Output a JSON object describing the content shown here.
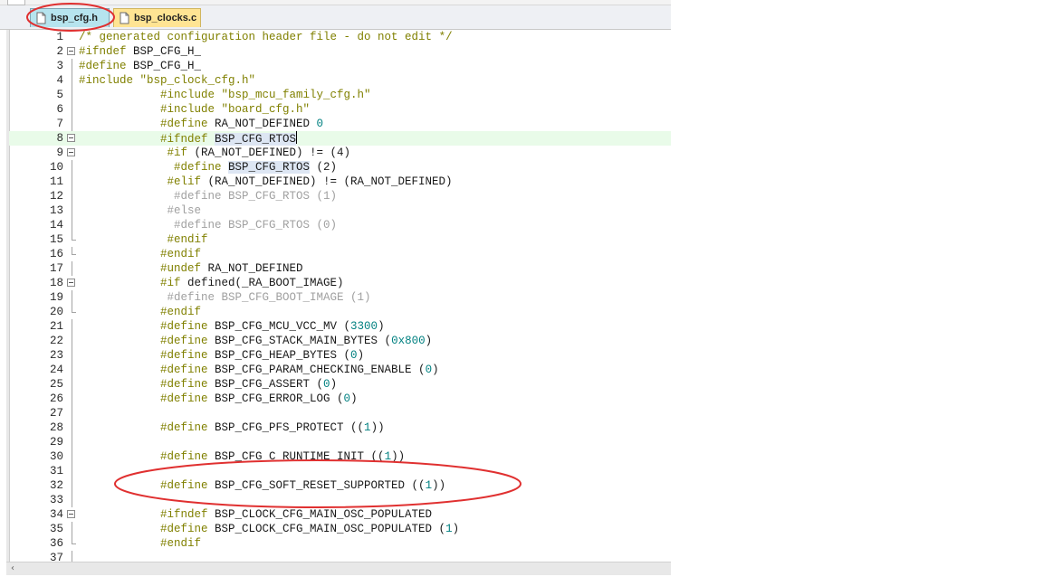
{
  "tabs": [
    {
      "label": "bsp_cfg.h",
      "active": true,
      "icon": "c-header-file-icon"
    },
    {
      "label": "bsp_clocks.c",
      "active": false,
      "icon": "c-source-file-icon"
    }
  ],
  "lines": [
    {
      "n": "1",
      "indent": 0,
      "cls": "comment",
      "segs": [
        [
          "/* generated configuration header file - do not edit */",
          ""
        ]
      ]
    },
    {
      "n": "2",
      "indent": 0,
      "fold": "open",
      "segs": [
        [
          "#ifndef",
          "pp"
        ],
        [
          " BSP_CFG_H_",
          ""
        ]
      ]
    },
    {
      "n": "3",
      "indent": 0,
      "fold": "bar",
      "segs": [
        [
          "#define",
          "pp"
        ],
        [
          " BSP_CFG_H_",
          ""
        ]
      ]
    },
    {
      "n": "4",
      "indent": 0,
      "fold": "bar",
      "segs": [
        [
          "#include",
          "pp"
        ],
        [
          " ",
          ""
        ],
        [
          "\"bsp_clock_cfg.h\"",
          "str"
        ]
      ]
    },
    {
      "n": "5",
      "indent": 12,
      "fold": "bar",
      "segs": [
        [
          "#include",
          "pp"
        ],
        [
          " ",
          ""
        ],
        [
          "\"bsp_mcu_family_cfg.h\"",
          "str"
        ]
      ]
    },
    {
      "n": "6",
      "indent": 12,
      "fold": "bar",
      "segs": [
        [
          "#include",
          "pp"
        ],
        [
          " ",
          ""
        ],
        [
          "\"board_cfg.h\"",
          "str"
        ]
      ]
    },
    {
      "n": "7",
      "indent": 12,
      "fold": "bar",
      "segs": [
        [
          "#define",
          "pp"
        ],
        [
          " RA_NOT_DEFINED ",
          ""
        ],
        [
          "0",
          "num"
        ]
      ]
    },
    {
      "n": "8",
      "indent": 12,
      "fold": "open",
      "hl": true,
      "cursor": true,
      "segs": [
        [
          "#ifndef",
          "pp"
        ],
        [
          " ",
          ""
        ],
        [
          "BSP_CFG_RTOS",
          "sel"
        ]
      ]
    },
    {
      "n": "9",
      "indent": 13,
      "fold": "open",
      "segs": [
        [
          "#if",
          "pp"
        ],
        [
          " (RA_NOT_DEFINED) != (4)",
          ""
        ]
      ]
    },
    {
      "n": "10",
      "indent": 14,
      "fold": "bar",
      "segs": [
        [
          "#define",
          "pp"
        ],
        [
          " ",
          ""
        ],
        [
          "BSP_CFG_RTOS",
          "sel"
        ],
        [
          " (2)",
          ""
        ]
      ]
    },
    {
      "n": "11",
      "indent": 13,
      "fold": "bar",
      "segs": [
        [
          "#elif",
          "pp"
        ],
        [
          " (RA_NOT_DEFINED) != (RA_NOT_DEFINED)",
          "dim"
        ]
      ]
    },
    {
      "n": "12",
      "indent": 14,
      "fold": "bar",
      "cls": "dim",
      "segs": [
        [
          "#define BSP_CFG_RTOS (1)",
          ""
        ]
      ]
    },
    {
      "n": "13",
      "indent": 13,
      "fold": "bar",
      "cls": "dim",
      "segs": [
        [
          "#else",
          ""
        ]
      ]
    },
    {
      "n": "14",
      "indent": 14,
      "fold": "bar",
      "cls": "dim",
      "segs": [
        [
          "#define BSP_CFG_RTOS (0)",
          ""
        ]
      ]
    },
    {
      "n": "15",
      "indent": 13,
      "fold": "end",
      "segs": [
        [
          "#endif",
          "pp"
        ]
      ]
    },
    {
      "n": "16",
      "indent": 12,
      "fold": "end",
      "segs": [
        [
          "#endif",
          "pp"
        ]
      ]
    },
    {
      "n": "17",
      "indent": 12,
      "fold": "bar",
      "segs": [
        [
          "#undef",
          "pp"
        ],
        [
          " RA_NOT_DEFINED",
          ""
        ]
      ]
    },
    {
      "n": "18",
      "indent": 12,
      "fold": "open",
      "segs": [
        [
          "#if",
          "pp"
        ],
        [
          " defined(_RA_BOOT_IMAGE)",
          ""
        ]
      ]
    },
    {
      "n": "19",
      "indent": 13,
      "fold": "bar",
      "cls": "dim",
      "segs": [
        [
          "#define BSP_CFG_BOOT_IMAGE (1)",
          ""
        ]
      ]
    },
    {
      "n": "20",
      "indent": 12,
      "fold": "end",
      "segs": [
        [
          "#endif",
          "pp"
        ]
      ]
    },
    {
      "n": "21",
      "indent": 12,
      "fold": "bar",
      "segs": [
        [
          "#define",
          "pp"
        ],
        [
          " BSP_CFG_MCU_VCC_MV (",
          ""
        ],
        [
          "3300",
          "num"
        ],
        [
          ")",
          ""
        ]
      ]
    },
    {
      "n": "22",
      "indent": 12,
      "fold": "bar",
      "segs": [
        [
          "#define",
          "pp"
        ],
        [
          " BSP_CFG_STACK_MAIN_BYTES (",
          ""
        ],
        [
          "0x800",
          "num"
        ],
        [
          ")",
          ""
        ]
      ]
    },
    {
      "n": "23",
      "indent": 12,
      "fold": "bar",
      "segs": [
        [
          "#define",
          "pp"
        ],
        [
          " BSP_CFG_HEAP_BYTES (",
          ""
        ],
        [
          "0",
          "num"
        ],
        [
          ")",
          ""
        ]
      ]
    },
    {
      "n": "24",
      "indent": 12,
      "fold": "bar",
      "segs": [
        [
          "#define",
          "pp"
        ],
        [
          " BSP_CFG_PARAM_CHECKING_ENABLE (",
          ""
        ],
        [
          "0",
          "num"
        ],
        [
          ")",
          ""
        ]
      ]
    },
    {
      "n": "25",
      "indent": 12,
      "fold": "bar",
      "segs": [
        [
          "#define",
          "pp"
        ],
        [
          " BSP_CFG_ASSERT (",
          ""
        ],
        [
          "0",
          "num"
        ],
        [
          ")",
          ""
        ]
      ]
    },
    {
      "n": "26",
      "indent": 12,
      "fold": "bar",
      "segs": [
        [
          "#define",
          "pp"
        ],
        [
          " BSP_CFG_ERROR_LOG (",
          ""
        ],
        [
          "0",
          "num"
        ],
        [
          ")",
          ""
        ]
      ]
    },
    {
      "n": "27",
      "indent": 0,
      "fold": "bar",
      "segs": []
    },
    {
      "n": "28",
      "indent": 12,
      "fold": "bar",
      "segs": [
        [
          "#define",
          "pp"
        ],
        [
          " BSP_CFG_PFS_PROTECT ((",
          ""
        ],
        [
          "1",
          "num"
        ],
        [
          "))",
          ""
        ]
      ]
    },
    {
      "n": "29",
      "indent": 0,
      "fold": "bar",
      "segs": []
    },
    {
      "n": "30",
      "indent": 12,
      "fold": "bar",
      "segs": [
        [
          "#define",
          "pp"
        ],
        [
          " BSP_CFG_C_RUNTIME_INIT ((",
          ""
        ],
        [
          "1",
          "num"
        ],
        [
          "))",
          ""
        ]
      ]
    },
    {
      "n": "31",
      "indent": 0,
      "fold": "bar",
      "segs": []
    },
    {
      "n": "32",
      "indent": 12,
      "fold": "bar",
      "segs": [
        [
          "#define",
          "pp"
        ],
        [
          " BSP_CFG_SOFT_RESET_SUPPORTED ((",
          ""
        ],
        [
          "1",
          "num"
        ],
        [
          "))",
          ""
        ]
      ]
    },
    {
      "n": "33",
      "indent": 0,
      "fold": "bar",
      "segs": []
    },
    {
      "n": "34",
      "indent": 12,
      "fold": "open",
      "segs": [
        [
          "#ifndef",
          "pp"
        ],
        [
          " BSP_CLOCK_CFG_MAIN_OSC_POPULATED",
          ""
        ]
      ]
    },
    {
      "n": "35",
      "indent": 12,
      "fold": "bar",
      "segs": [
        [
          "#define",
          "pp"
        ],
        [
          " BSP_CLOCK_CFG_MAIN_OSC_POPULATED (",
          ""
        ],
        [
          "1",
          "num"
        ],
        [
          ")",
          ""
        ]
      ]
    },
    {
      "n": "36",
      "indent": 12,
      "fold": "end",
      "segs": [
        [
          "#endif",
          "pp"
        ]
      ]
    },
    {
      "n": "37",
      "indent": 0,
      "fold": "bar",
      "segs": []
    }
  ],
  "annotations": [
    {
      "name": "tab-highlight-ellipse",
      "color": "#e03030"
    },
    {
      "name": "line-highlight-ellipse",
      "color": "#e03030"
    }
  ],
  "scrollbar": {
    "left_arrow": "‹"
  }
}
